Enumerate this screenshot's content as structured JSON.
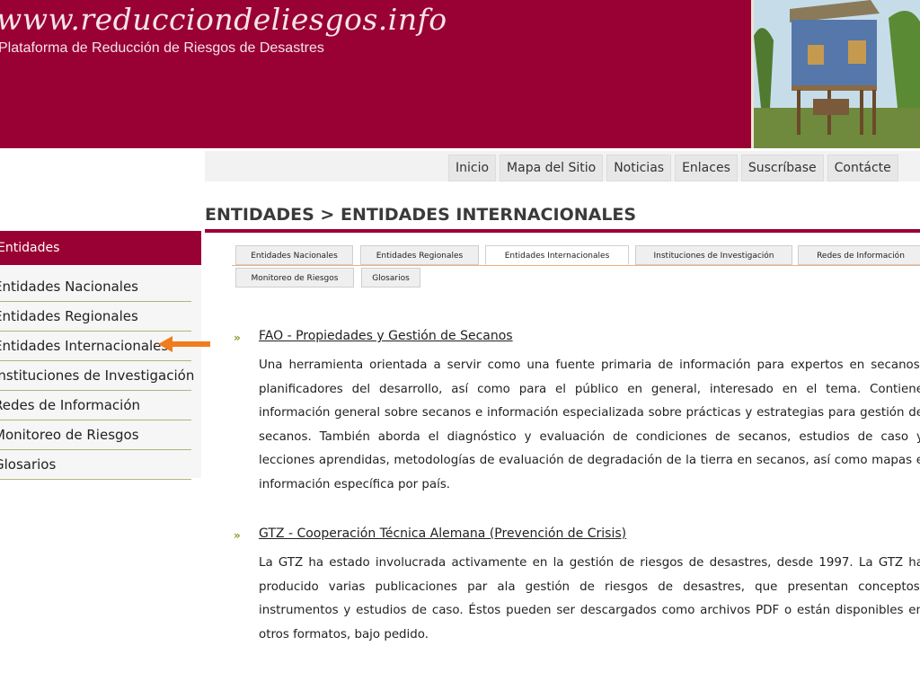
{
  "header": {
    "site_url": "www.reducciondeliesgos.info",
    "tagline": "Plataforma de Reducción de Riesgos de Desastres"
  },
  "topnav": [
    "Inicio",
    "Mapa del Sitio",
    "Noticias",
    "Enlaces",
    "Suscríbase",
    "Contácte"
  ],
  "page_title": "ENTIDADES > ENTIDADES INTERNACIONALES",
  "sidebar": {
    "title": "Entidades",
    "items": [
      {
        "label": "Entidades Nacionales"
      },
      {
        "label": "Entidades Regionales"
      },
      {
        "label": "Entidades Internacionales",
        "active": true
      },
      {
        "label": "Instituciones de Investigación"
      },
      {
        "label": "Redes de Información"
      },
      {
        "label": "Monitoreo de Riesgos"
      },
      {
        "label": "Glosarios"
      }
    ]
  },
  "tabs": [
    {
      "label": "Entidades Nacionales"
    },
    {
      "label": "Entidades Regionales"
    },
    {
      "label": "Entidades Internacionales",
      "active": true
    },
    {
      "label": "Instituciones de Investigación"
    },
    {
      "label": "Redes de Información"
    },
    {
      "label": "Monitoreo de Riesgos"
    },
    {
      "label": "Glosarios"
    }
  ],
  "entries": [
    {
      "title": "FAO - Propiedades y Gestión de Secanos",
      "description": "Una herramienta orientada a servir como una fuente primaria de información para expertos en secanos, planificadores del desarrollo, así como para el público en general, interesado en el tema. Contiene información general sobre secanos e información especializada sobre prácticas y estrategias para gestión de secanos. También aborda el diagnóstico y evaluación de condiciones de secanos, estudios de caso y lecciones aprendidas, metodologías de evaluación de degradación de la tierra en secanos, así como mapas e información específica por país."
    },
    {
      "title": "GTZ - Cooperación Técnica Alemana (Prevención de Crisis)",
      "description": "La GTZ ha estado involucrada activamente en la gestión de riesgos de desastres, desde 1997. La GTZ ha producido varias publicaciones par ala gestión de riesgos de desastres, que presentan conceptos, instrumentos y estudios de caso. Éstos pueden ser descargados como archivos PDF o están disponibles en otros formatos, bajo pedido."
    }
  ],
  "colors": {
    "brand": "#990033",
    "arrow": "#f07c1e",
    "sidebar_rule": "#b4b27c",
    "bullet": "#8a9a2a"
  },
  "icons": {
    "pointer_arrow": "arrow-left-icon",
    "entry_bullet": "double-chevron-right-icon"
  }
}
